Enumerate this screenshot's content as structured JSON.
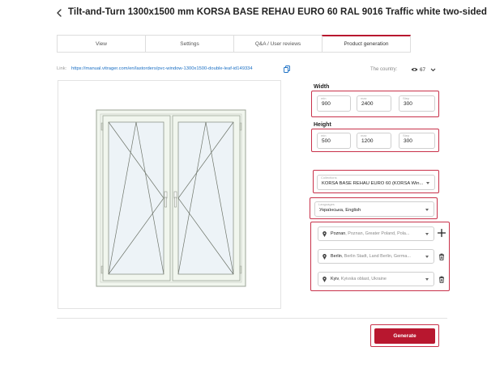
{
  "header": {
    "title": "Tilt-and-Turn 1300x1500 mm KORSA BASE REHAU EURO 60 RAL 9016 Traffic white two-sided"
  },
  "tabs": [
    {
      "label": "View",
      "active": false
    },
    {
      "label": "Settings",
      "active": false
    },
    {
      "label": "Q&A / User reviews",
      "active": false
    },
    {
      "label": "Product generation",
      "active": true
    }
  ],
  "link": {
    "label": "Link:",
    "url": "https://manual.vitrager.com/en/lastorders/pvc-window-1300x1500-double-leaf-id149334"
  },
  "country": {
    "label": "The country:",
    "value": "67"
  },
  "width": {
    "title": "Width",
    "fields": [
      {
        "label": "min",
        "value": "900"
      },
      {
        "label": "max",
        "value": "2400"
      },
      {
        "label": "Step",
        "value": "300"
      }
    ]
  },
  "height": {
    "title": "Height",
    "fields": [
      {
        "label": "min",
        "value": "500"
      },
      {
        "label": "max",
        "value": "1200"
      },
      {
        "label": "Step",
        "value": "300"
      }
    ]
  },
  "collections": {
    "label": "Collections",
    "value": "KORSA BASE REHAU EURO 60 (KORSA Win..."
  },
  "languages": {
    "label": "Languages",
    "value": "Українська, English"
  },
  "locations": [
    {
      "city": "Poznan",
      "detail": ", Poznan, Greater Poland, Pola..."
    },
    {
      "city": "Berlin",
      "detail": ", Berlin Stadt, Land Berlin, Germa..."
    },
    {
      "city": "Kyiv",
      "detail": ", Kyivska oblast, Ukraine"
    }
  ],
  "actions": {
    "generate": "Generate"
  },
  "colors": {
    "accent": "#b8172f",
    "highlight": "#c8314a",
    "link": "#1a6fc4",
    "frame": "#f1f6ee"
  },
  "icons": {
    "back": "chevron-left-icon",
    "copy": "copy-icon",
    "eye": "eye-icon",
    "pin": "map-pin-icon",
    "plus": "plus-icon",
    "trash": "trash-icon"
  }
}
